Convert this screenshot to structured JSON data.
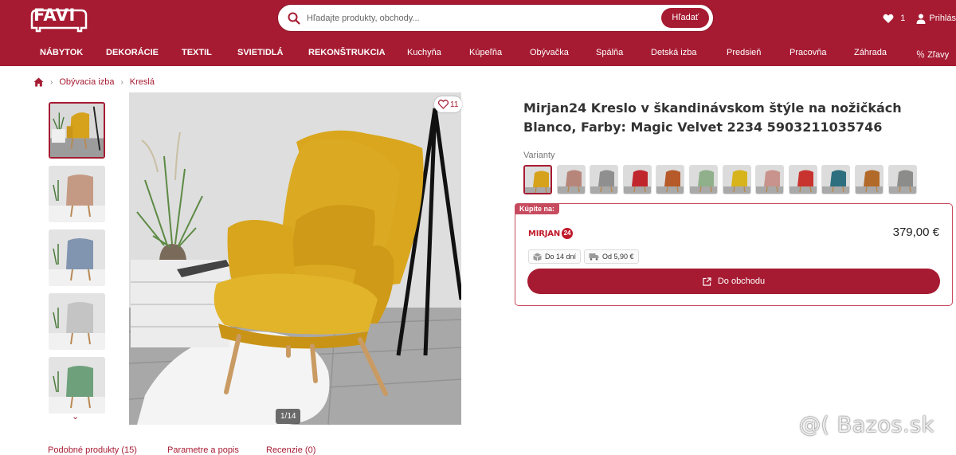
{
  "header": {
    "logo_text": "FAVI",
    "search_placeholder": "Hľadajte produkty, obchody...",
    "search_button": "Hľadať",
    "favorites_count": "1",
    "login_label": "Prihlás"
  },
  "nav": {
    "items": [
      {
        "label": "NÁBYTOK"
      },
      {
        "label": "DEKORÁCIE"
      },
      {
        "label": "TEXTIL"
      },
      {
        "label": "SVIETIDLÁ"
      },
      {
        "label": "REKONŠTRUKCIA"
      },
      {
        "label": "Kuchyňa"
      },
      {
        "label": "Kúpeľňa"
      },
      {
        "label": "Obývačka"
      },
      {
        "label": "Spálňa"
      },
      {
        "label": "Detská izba"
      },
      {
        "label": "Predsieň"
      },
      {
        "label": "Pracovňa"
      },
      {
        "label": "Záhrada"
      },
      {
        "label": "Zľavy"
      }
    ]
  },
  "breadcrumb": {
    "items": [
      "Obývacia izba",
      "Kreslá"
    ]
  },
  "gallery": {
    "likes": "11",
    "counter": "1/14"
  },
  "product": {
    "title": "Mirjan24 Kreslo v škandinávskom štýle na nožičkách Blanco, Farby: Magic Velvet 2234 5903211035746",
    "variants_label": "Varianty",
    "variant_colors": [
      "#d6a21c",
      "#b7867a",
      "#8f8f8f",
      "#c0272d",
      "#b65a2a",
      "#8fb08a",
      "#d7b41c",
      "#c8938c",
      "#c8332f",
      "#2d6f7f",
      "#b26a2a",
      "#8c8c8a"
    ]
  },
  "offer": {
    "tag": "Kúpite na:",
    "shop_name": "MIRJAN",
    "shop_number": "24",
    "price": "379,00 €",
    "delivery_time": "Do 14 dní",
    "shipping": "Od 5,90 €",
    "button": "Do obchodu"
  },
  "tabs": {
    "items": [
      "Podobné produkty (15)",
      "Parametre a popis",
      "Recenzie (0)"
    ]
  },
  "watermark": "@( Bazos.sk",
  "colors": {
    "brand": "#a61b32",
    "accent_border": "#c74b5f"
  }
}
